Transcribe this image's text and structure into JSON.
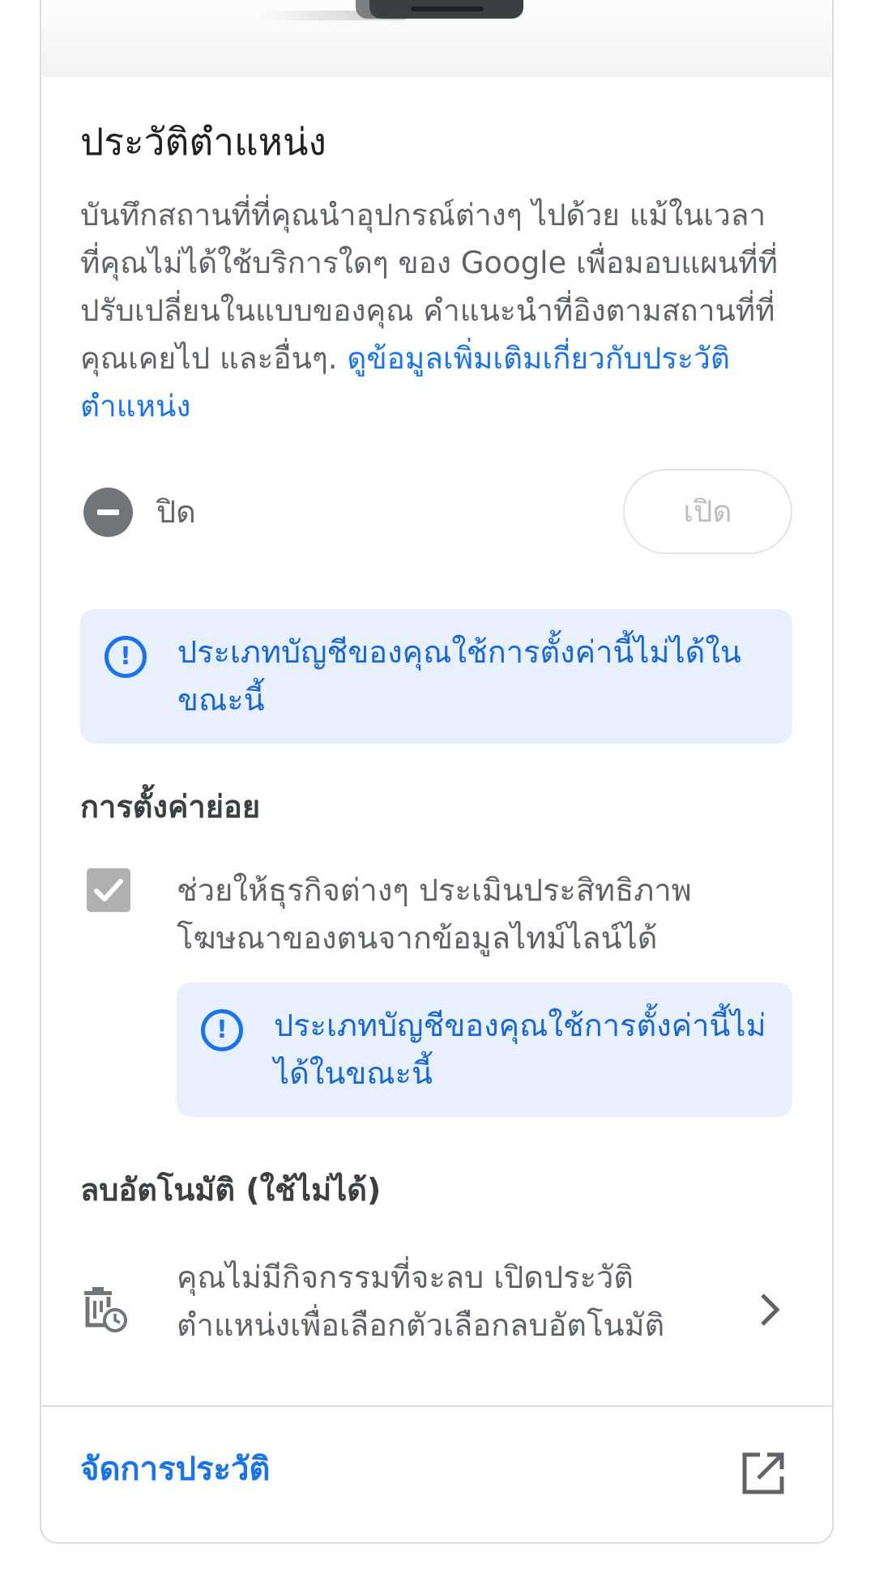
{
  "location_history": {
    "title": "ประวัติตำแหน่ง",
    "description": "บันทึกสถานที่ที่คุณนำอุปกรณ์ต่างๆ ไปด้วย แม้ในเวลาที่คุณไม่ได้ใช้บริการใดๆ ของ Google เพื่อมอบแผนที่ที่ปรับเปลี่ยนในแบบของคุณ คำแนะนำที่อิงตามสถานที่ที่คุณเคยไป และอื่นๆ.",
    "learn_more_link": "ดูข้อมูลเพิ่มเติมเกี่ยวกับประวัติตำแหน่ง",
    "status_label": "ปิด",
    "status_icon": "minus-circle-icon",
    "turn_on_button": "เปิด",
    "notice": "ประเภทบัญชีของคุณใช้การตั้งค่านี้ไม่ได้ในขณะนี้"
  },
  "subsettings": {
    "heading": "การตั้งค่าย่อย",
    "checkbox_label": "ช่วยให้ธุรกิจต่างๆ ประเมินประสิทธิภาพโฆษณาของตนจากข้อมูลไทม์ไลน์ได้",
    "checkbox_checked": true,
    "notice": "ประเภทบัญชีของคุณใช้การตั้งค่านี้ไม่ได้ในขณะนี้"
  },
  "auto_delete": {
    "heading": "ลบอัตโนมัติ (ใช้ไม่ได้)",
    "text": "คุณไม่มีกิจกรรมที่จะลบ เปิดประวัติตำแหน่งเพื่อเลือกตัวเลือกลบอัตโนมัติ",
    "icon": "auto-delete-icon"
  },
  "footer": {
    "manage_link": "จัดการประวัติ",
    "icon": "open-in-new-icon"
  },
  "colors": {
    "accent": "#1a73e8",
    "info_bg": "#e8f0fe",
    "text_primary": "#202124",
    "text_secondary": "#5f6368",
    "border": "#dadce0"
  }
}
